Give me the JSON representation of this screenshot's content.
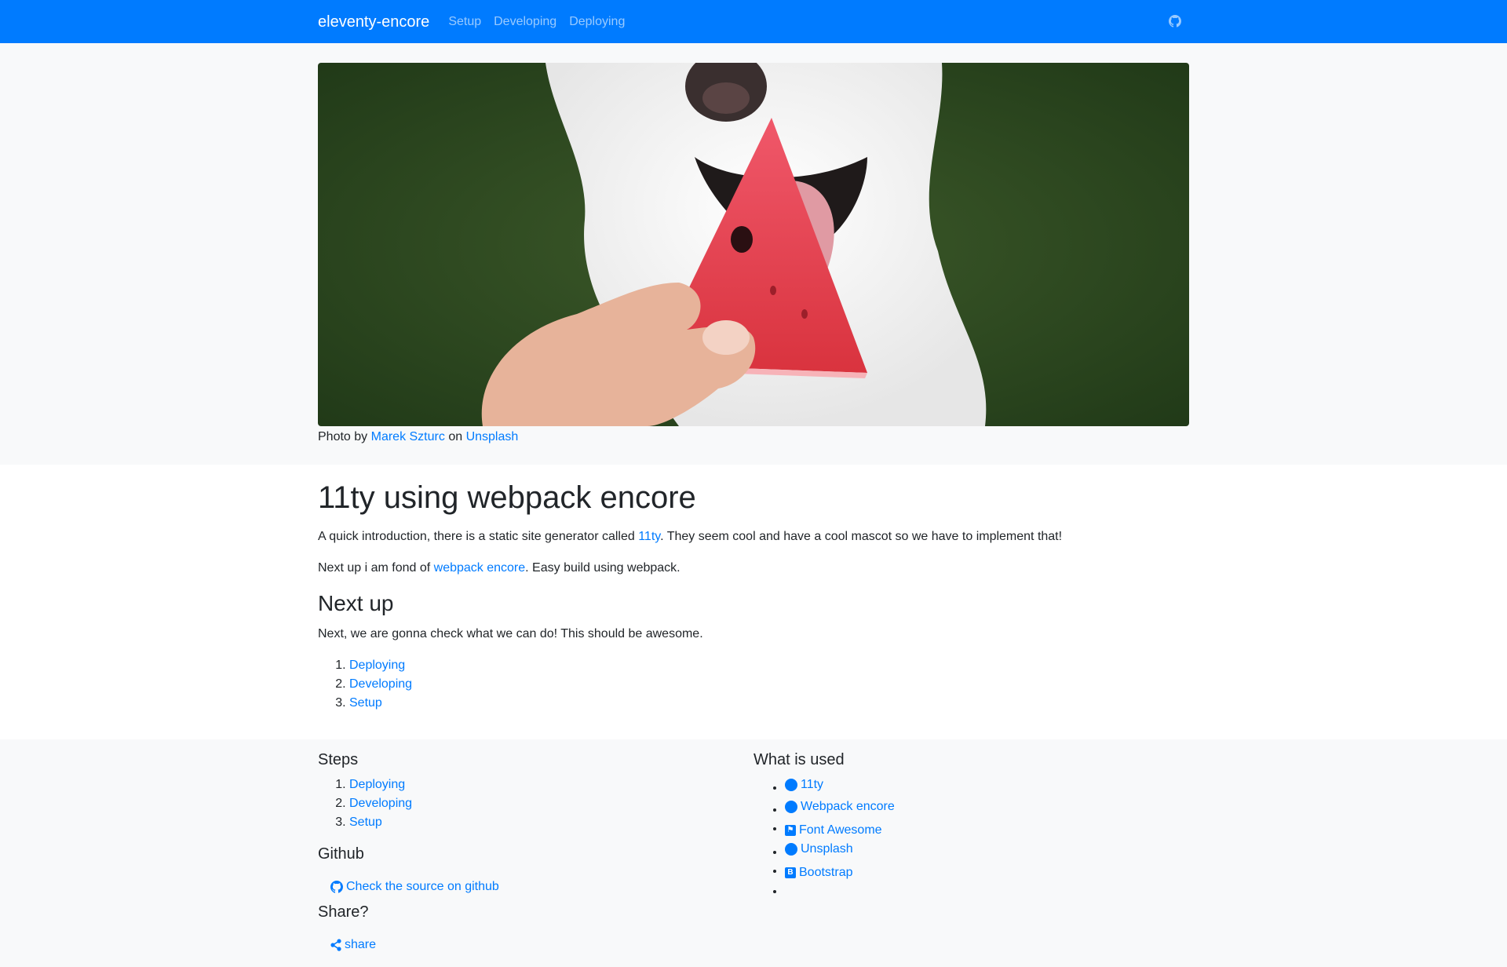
{
  "navbar": {
    "brand": "eleventy-encore",
    "links": [
      "Setup",
      "Developing",
      "Deploying"
    ],
    "github_icon": "github-icon"
  },
  "hero": {
    "image_alt": "Dog licking a slice of watermelon",
    "caption_prefix": "Photo by",
    "author": "Marek Szturc",
    "caption_mid": "on",
    "source": "Unsplash"
  },
  "main": {
    "title": "11ty using webpack encore",
    "intro_before": "A quick introduction, there is a static site generator called ",
    "intro_link": "11ty",
    "intro_after": ". They seem cool and have a cool mascot so we have to implement that!",
    "p2_before": "Next up i am fond of ",
    "p2_link": "webpack encore",
    "p2_after": ". Easy build using webpack.",
    "subtitle": "Next up",
    "p3": "Next, we are gonna check what we can do! This should be awesome.",
    "steps": [
      "Deploying",
      "Developing",
      "Setup"
    ]
  },
  "footer": {
    "steps_title": "Steps",
    "steps": [
      "Deploying",
      "Developing",
      "Setup"
    ],
    "github_title": "Github",
    "github_link": "Check the source on github",
    "share_title": "Share?",
    "share_link": "share",
    "used_title": "What is used",
    "used": [
      {
        "label": "11ty",
        "icon": "circle-icon"
      },
      {
        "label": "Webpack encore",
        "icon": "circle-icon"
      },
      {
        "label": "Font Awesome",
        "icon": "flag-icon"
      },
      {
        "label": "Unsplash",
        "icon": "circle-icon"
      },
      {
        "label": "Bootstrap",
        "icon": "bootstrap-icon"
      }
    ]
  },
  "colors": {
    "primary": "#007bff",
    "light_bg": "#f8f9fa",
    "text": "#212529"
  }
}
